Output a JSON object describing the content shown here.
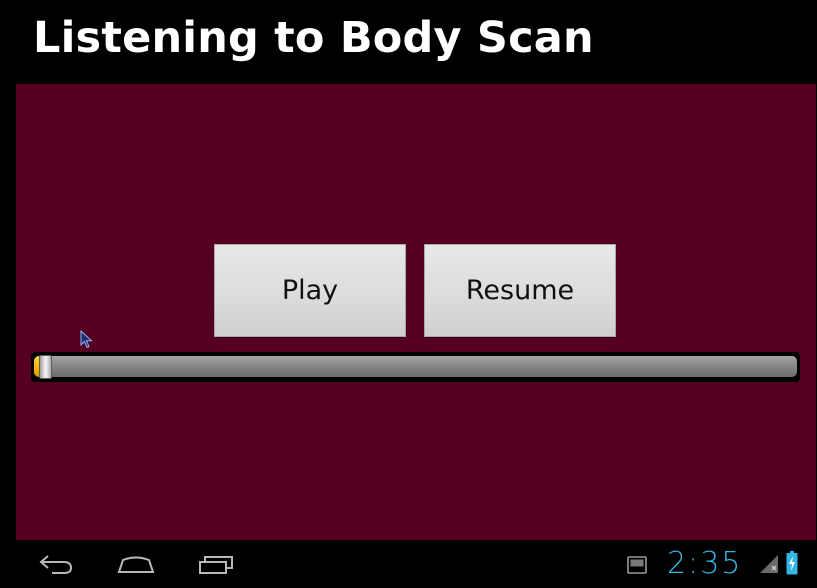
{
  "app": {
    "title": "Listening to Body Scan"
  },
  "player": {
    "play_label": "Play",
    "resume_label": "Resume",
    "seek_progress": 0.01
  },
  "nav_bar": {
    "back_icon": "back-arrow-icon",
    "home_icon": "home-icon",
    "recents_icon": "recent-apps-icon"
  },
  "status_bar": {
    "time": "2:35",
    "clock_color": "#33b5e5",
    "signal_icon": "signal-icon",
    "battery_icon": "battery-charging-icon"
  },
  "colors": {
    "content_background": "#550020",
    "seek_progress": "#f3b300"
  }
}
